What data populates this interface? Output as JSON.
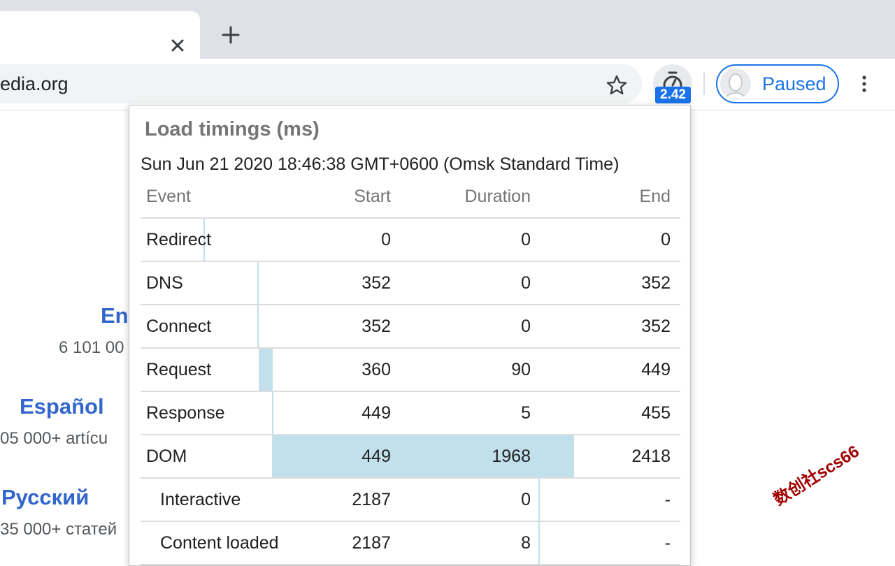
{
  "browser": {
    "url": "edia.org",
    "extension_badge": "2.42",
    "profile_label": "Paused"
  },
  "page": {
    "languages": [
      {
        "name": "Eng",
        "count": "6 101 00"
      },
      {
        "name": "Español",
        "count": "05 000+ artícu"
      },
      {
        "name": "Русский",
        "count": "35 000+ статей"
      }
    ]
  },
  "popup": {
    "title": "Load timings (ms)",
    "date": "Sun Jun 21 2020 18:46:38 GMT+0600 (Omsk Standard Time)",
    "columns": {
      "event": "Event",
      "start": "Start",
      "duration": "Duration",
      "end": "End"
    },
    "rows": [
      {
        "event": "Redirect",
        "start": "0",
        "duration": "0",
        "end": "0",
        "bar_start_ms": 0,
        "bar_duration_ms": 0,
        "sub": false
      },
      {
        "event": "DNS",
        "start": "352",
        "duration": "0",
        "end": "352",
        "bar_start_ms": 352,
        "bar_duration_ms": 0,
        "sub": false
      },
      {
        "event": "Connect",
        "start": "352",
        "duration": "0",
        "end": "352",
        "bar_start_ms": 352,
        "bar_duration_ms": 0,
        "sub": false
      },
      {
        "event": "Request",
        "start": "360",
        "duration": "90",
        "end": "449",
        "bar_start_ms": 360,
        "bar_duration_ms": 90,
        "sub": false
      },
      {
        "event": "Response",
        "start": "449",
        "duration": "5",
        "end": "455",
        "bar_start_ms": 449,
        "bar_duration_ms": 5,
        "sub": false
      },
      {
        "event": "DOM",
        "start": "449",
        "duration": "1968",
        "end": "2418",
        "bar_start_ms": 449,
        "bar_duration_ms": 1968,
        "sub": false
      },
      {
        "event": "Interactive",
        "start": "2187",
        "duration": "0",
        "end": "-",
        "bar_start_ms": 2187,
        "bar_duration_ms": 0,
        "sub": true
      },
      {
        "event": "Content loaded",
        "start": "2187",
        "duration": "8",
        "end": "-",
        "bar_start_ms": 2187,
        "bar_duration_ms": 8,
        "sub": true
      }
    ],
    "total_ms": 2418
  },
  "watermark": "数创社scs66",
  "colors": {
    "accent": "#1a73e8",
    "bar": "#c2dfec",
    "link": "#3366cc"
  }
}
